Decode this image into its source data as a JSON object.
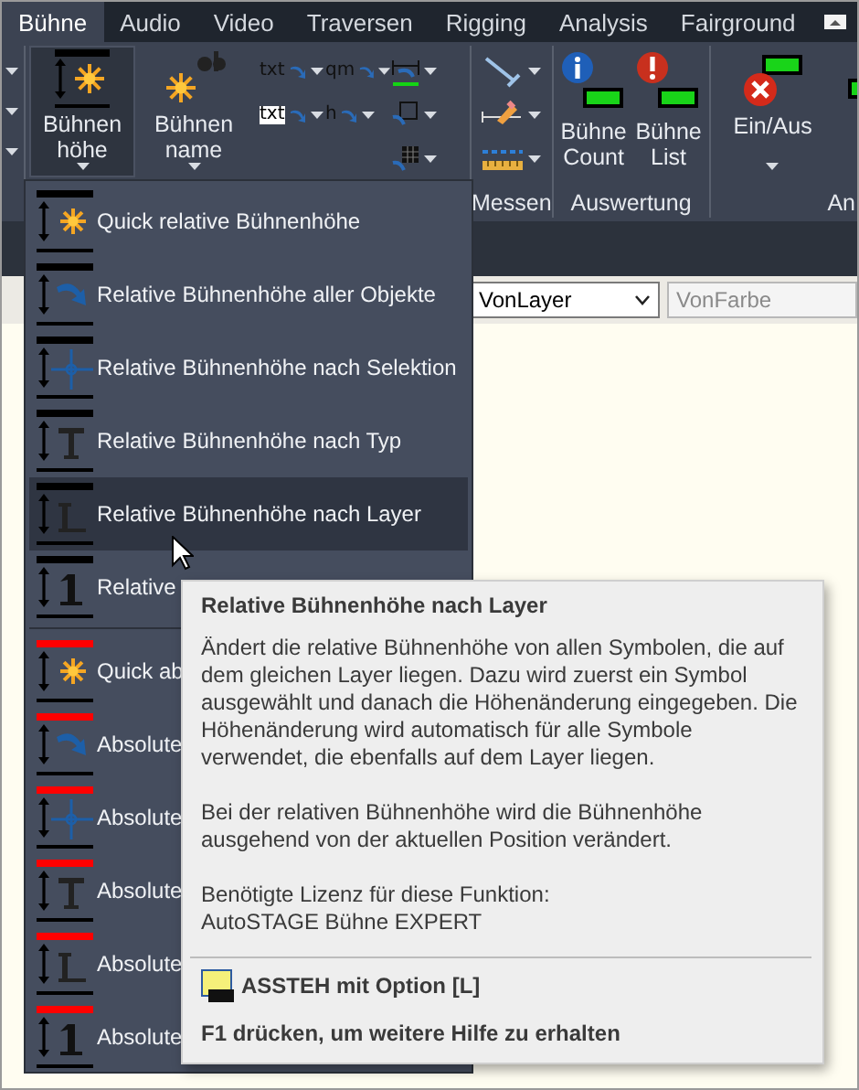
{
  "tabs": [
    {
      "label": "Bühne",
      "selected": true
    },
    {
      "label": "Audio",
      "selected": false
    },
    {
      "label": "Video",
      "selected": false
    },
    {
      "label": "Traversen",
      "selected": false
    },
    {
      "label": "Rigging",
      "selected": false
    },
    {
      "label": "Analysis",
      "selected": false
    },
    {
      "label": "Fairground",
      "selected": false
    }
  ],
  "ribbon": {
    "main_buttons": [
      {
        "label": "Bühnen\nhöhe",
        "kind": "height",
        "open": true
      },
      {
        "label": "Bühnen\nname",
        "kind": "name",
        "open": false
      }
    ],
    "small_tools": [
      {
        "kind": "text",
        "text": "txt"
      },
      {
        "kind": "text",
        "text": "qm"
      },
      {
        "kind": "dimension"
      },
      {
        "kind": "boxed-text",
        "text": "txt"
      },
      {
        "kind": "text",
        "text": "h"
      },
      {
        "kind": "square"
      },
      {
        "kind": "blank"
      },
      {
        "kind": "blank"
      },
      {
        "kind": "grid"
      }
    ],
    "measure_group": {
      "label": "Messen",
      "tools": [
        {
          "kind": "line"
        },
        {
          "kind": "pencil"
        },
        {
          "kind": "ruler"
        }
      ]
    },
    "evaluation_group": {
      "label": "Auswertung",
      "buttons": [
        {
          "label": "Bühne\nCount",
          "kind": "info"
        },
        {
          "label": "Bühne\nList",
          "kind": "alert"
        }
      ]
    },
    "toggle_group": {
      "label": "An",
      "button": {
        "label": "Ein/Aus"
      }
    }
  },
  "property_bar": {
    "linetype": "VonLayer",
    "color_field": "VonFarbe"
  },
  "menu": {
    "items": [
      {
        "label": "Quick relative Bühnenhöhe",
        "kind": "quick",
        "absolute": false,
        "selected": false
      },
      {
        "label": "Relative Bühnenhöhe aller Objekte",
        "kind": "all",
        "absolute": false,
        "selected": false
      },
      {
        "label": "Relative Bühnenhöhe nach Selektion",
        "kind": "selection",
        "absolute": false,
        "selected": false
      },
      {
        "label": "Relative Bühnenhöhe nach Typ",
        "kind": "type",
        "absolute": false,
        "selected": false
      },
      {
        "label": "Relative Bühnenhöhe nach Layer",
        "kind": "layer",
        "absolute": false,
        "selected": true
      },
      {
        "label": "Relative",
        "kind": "single",
        "absolute": false,
        "selected": false
      },
      {
        "kind": "separator"
      },
      {
        "label": "Quick ab",
        "kind": "quick",
        "absolute": true,
        "selected": false
      },
      {
        "label": "Absolute",
        "kind": "all",
        "absolute": true,
        "selected": false
      },
      {
        "label": "Absolute",
        "kind": "selection",
        "absolute": true,
        "selected": false
      },
      {
        "label": "Absolute",
        "kind": "type",
        "absolute": true,
        "selected": false
      },
      {
        "label": "Absolute",
        "kind": "layer",
        "absolute": true,
        "selected": false
      },
      {
        "label": "Absolute",
        "kind": "single",
        "absolute": true,
        "selected": false
      }
    ]
  },
  "tooltip": {
    "title": "Relative Bühnenhöhe nach Layer",
    "paragraphs": [
      "Ändert die relative Bühnenhöhe von allen Symbolen, die auf dem gleichen Layer liegen. Dazu wird zuerst ein Symbol ausgewählt und danach die Höhenänderung eingegeben. Die Höhenänderung wird automatisch für alle Symbole verwendet, die ebenfalls auf dem Layer liegen.",
      "Bei der relativen Bühnenhöhe wird die Bühnenhöhe ausgehend von der aktuellen Position verändert.",
      "Benötigte Lizenz für diese Funktion:\nAutoSTAGE Bühne EXPERT"
    ],
    "command": "ASSTEH mit Option [L]",
    "help": "F1 drücken, um weitere Hilfe zu erhalten"
  }
}
